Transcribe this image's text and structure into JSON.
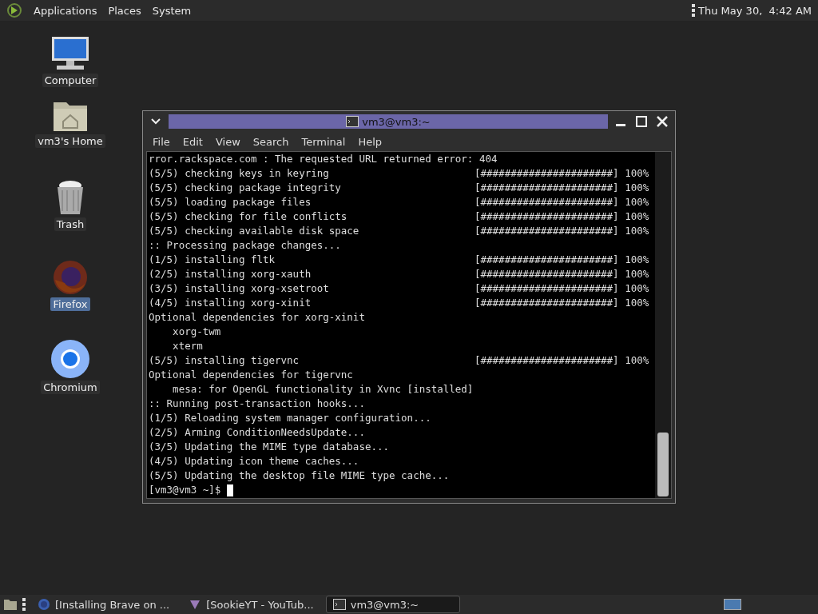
{
  "top_panel": {
    "menus": [
      "Applications",
      "Places",
      "System"
    ],
    "clock": "Thu May 30,  4:42 AM"
  },
  "desktop_icons": [
    {
      "label": "Computer",
      "kind": "computer",
      "selected": false
    },
    {
      "label": "vm3's Home",
      "kind": "home",
      "selected": false
    },
    {
      "label": "Trash",
      "kind": "trash",
      "selected": false
    },
    {
      "label": "Firefox",
      "kind": "firefox",
      "selected": true
    },
    {
      "label": "Chromium",
      "kind": "chromium",
      "selected": false
    }
  ],
  "window": {
    "title": "vm3@vm3:~",
    "menu": [
      "File",
      "Edit",
      "View",
      "Search",
      "Terminal",
      "Help"
    ],
    "lines": [
      {
        "text": "rror.rackspace.com : The requested URL returned error: 404"
      },
      {
        "text": "(5/5) checking keys in keyring",
        "bar": "[######################]",
        "percent": "100%"
      },
      {
        "text": "(5/5) checking package integrity",
        "bar": "[######################]",
        "percent": "100%"
      },
      {
        "text": "(5/5) loading package files",
        "bar": "[######################]",
        "percent": "100%"
      },
      {
        "text": "(5/5) checking for file conflicts",
        "bar": "[######################]",
        "percent": "100%"
      },
      {
        "text": "(5/5) checking available disk space",
        "bar": "[######################]",
        "percent": "100%"
      },
      {
        "text": ":: Processing package changes..."
      },
      {
        "text": "(1/5) installing fltk",
        "bar": "[######################]",
        "percent": "100%"
      },
      {
        "text": "(2/5) installing xorg-xauth",
        "bar": "[######################]",
        "percent": "100%"
      },
      {
        "text": "(3/5) installing xorg-xsetroot",
        "bar": "[######################]",
        "percent": "100%"
      },
      {
        "text": "(4/5) installing xorg-xinit",
        "bar": "[######################]",
        "percent": "100%"
      },
      {
        "text": "Optional dependencies for xorg-xinit"
      },
      {
        "text": "    xorg-twm"
      },
      {
        "text": "    xterm"
      },
      {
        "text": "(5/5) installing tigervnc",
        "bar": "[######################]",
        "percent": "100%"
      },
      {
        "text": "Optional dependencies for tigervnc"
      },
      {
        "text": "    mesa: for OpenGL functionality in Xvnc [installed]"
      },
      {
        "text": ":: Running post-transaction hooks..."
      },
      {
        "text": "(1/5) Reloading system manager configuration..."
      },
      {
        "text": "(2/5) Arming ConditionNeedsUpdate..."
      },
      {
        "text": "(3/5) Updating the MIME type database..."
      },
      {
        "text": "(4/5) Updating icon theme caches..."
      },
      {
        "text": "(5/5) Updating the desktop file MIME type cache..."
      }
    ],
    "prompt": "[vm3@vm3 ~]$ "
  },
  "taskbar": {
    "tasks": [
      {
        "label": "[Installing Brave on ...",
        "kind": "browser",
        "selected": false
      },
      {
        "label": "[SookieYT - YouTub...",
        "kind": "video",
        "selected": false
      },
      {
        "label": "vm3@vm3:~",
        "kind": "terminal",
        "selected": true
      }
    ]
  }
}
